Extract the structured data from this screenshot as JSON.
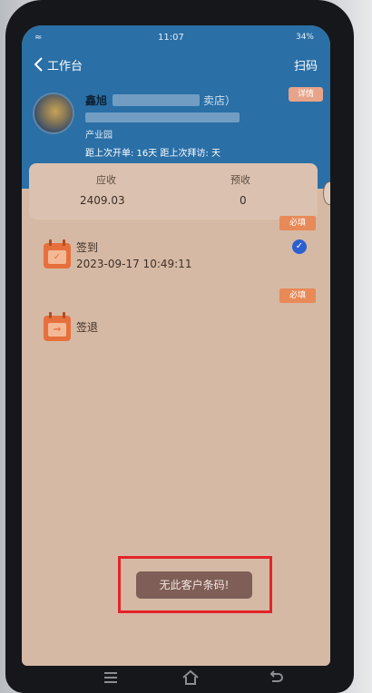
{
  "status": {
    "left": "≈",
    "time": "11:07",
    "right": "34%"
  },
  "nav": {
    "back_label": "工作台",
    "scan_label": "扫码"
  },
  "customer": {
    "name_partial": "鑫旭",
    "name_suffix": "卖店）",
    "address_partial": "产业园",
    "stats": "距上次开单: 16天 距上次拜访: 天",
    "detail_button": "详情"
  },
  "summary": {
    "receivable_label": "应收",
    "receivable_value": "2409.03",
    "prepaid_label": "预收",
    "prepaid_value": "0"
  },
  "checkin": {
    "tag": "必填",
    "label": "签到",
    "time": "2023-09-17 10:49:11"
  },
  "checkout": {
    "tag": "必填",
    "label": "签退"
  },
  "toast": {
    "message": "无此客户条码!"
  },
  "colors": {
    "header": "#2a6fa6",
    "screen": "#d6b9a4",
    "accent": "#e6703c",
    "highlight": "#e2242a"
  }
}
